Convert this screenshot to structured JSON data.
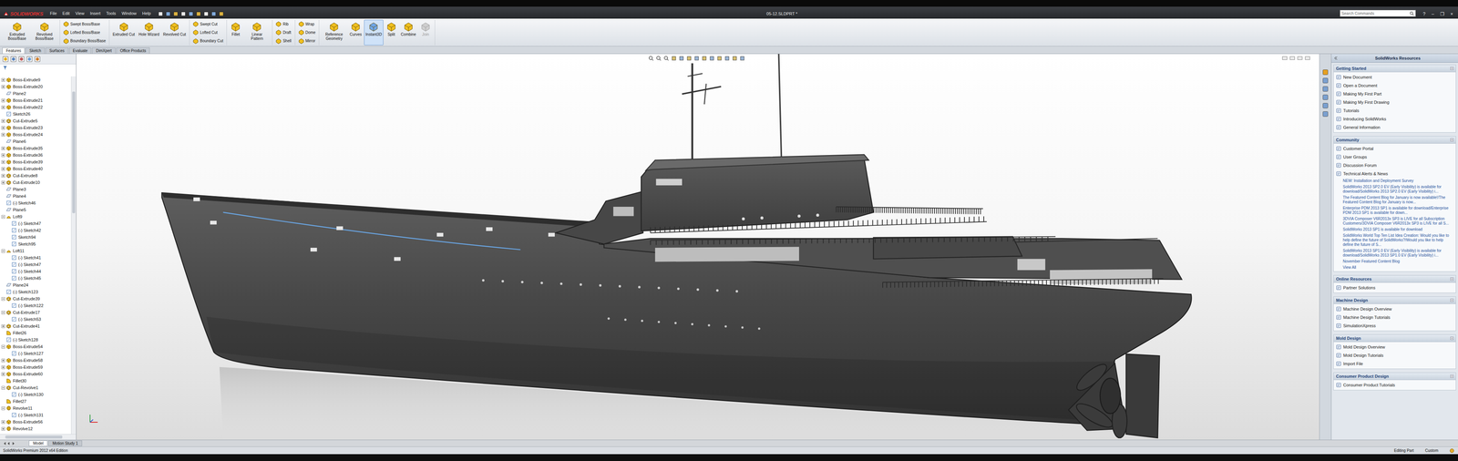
{
  "window": {
    "logo": "SOLIDWORKS",
    "title": "05-12.SLDPRT *",
    "controls": [
      "?",
      "–",
      "❐",
      "×"
    ]
  },
  "menu": [
    "File",
    "Edit",
    "View",
    "Insert",
    "Tools",
    "Window",
    "Help"
  ],
  "search": {
    "placeholder": "Search Commands"
  },
  "command_groups": [
    {
      "kind": "big",
      "items": [
        {
          "label": "Extruded Boss/Base",
          "selected": false,
          "disabled": false
        },
        {
          "label": "Revolved Boss/Base",
          "selected": false,
          "disabled": false
        }
      ]
    },
    {
      "kind": "stack",
      "items": [
        {
          "label": "Swept Boss/Base",
          "selected": false,
          "disabled": false
        },
        {
          "label": "Lofted Boss/Base",
          "selected": false,
          "disabled": false
        },
        {
          "label": "Boundary Boss/Base",
          "selected": false,
          "disabled": false
        }
      ]
    },
    {
      "kind": "big",
      "items": [
        {
          "label": "Extruded Cut",
          "selected": false,
          "disabled": false
        },
        {
          "label": "Hole Wizard",
          "selected": false,
          "disabled": false
        },
        {
          "label": "Revolved Cut",
          "selected": false,
          "disabled": false
        }
      ]
    },
    {
      "kind": "stack",
      "items": [
        {
          "label": "Swept Cut",
          "selected": false,
          "disabled": false
        },
        {
          "label": "Lofted Cut",
          "selected": false,
          "disabled": false
        },
        {
          "label": "Boundary Cut",
          "selected": false,
          "disabled": false
        }
      ]
    },
    {
      "kind": "big",
      "items": [
        {
          "label": "Fillet",
          "selected": false,
          "disabled": false
        },
        {
          "label": "Linear Pattern",
          "selected": false,
          "disabled": false
        }
      ]
    },
    {
      "kind": "stack",
      "items": [
        {
          "label": "Rib",
          "selected": false,
          "disabled": false
        },
        {
          "label": "Draft",
          "selected": false,
          "disabled": false
        },
        {
          "label": "Shell",
          "selected": false,
          "disabled": false
        }
      ]
    },
    {
      "kind": "stack",
      "items": [
        {
          "label": "Wrap",
          "selected": false,
          "disabled": false
        },
        {
          "label": "Dome",
          "selected": false,
          "disabled": false
        },
        {
          "label": "Mirror",
          "selected": false,
          "disabled": false
        }
      ]
    },
    {
      "kind": "big",
      "items": [
        {
          "label": "Reference Geometry",
          "selected": false,
          "disabled": false
        },
        {
          "label": "Curves",
          "selected": false,
          "disabled": false
        },
        {
          "label": "Instant3D",
          "selected": true,
          "disabled": false
        },
        {
          "label": "Split",
          "selected": false,
          "disabled": false
        },
        {
          "label": "Combine",
          "selected": false,
          "disabled": false
        },
        {
          "label": "Join",
          "selected": false,
          "disabled": true
        }
      ]
    }
  ],
  "command_tabs": [
    {
      "label": "Features",
      "selected": true
    },
    {
      "label": "Sketch",
      "selected": false
    },
    {
      "label": "Surfaces",
      "selected": false
    },
    {
      "label": "Evaluate",
      "selected": false
    },
    {
      "label": "DimXpert",
      "selected": false
    },
    {
      "label": "Office Products",
      "selected": false
    }
  ],
  "feature_tree": [
    {
      "label": "Boss-Extrude9",
      "kind": "extrude",
      "expanded": false
    },
    {
      "label": "Boss-Extrude20",
      "kind": "extrude",
      "expanded": false
    },
    {
      "label": "Plane2",
      "kind": "plane",
      "expanded": false
    },
    {
      "label": "Boss-Extrude21",
      "kind": "extrude",
      "expanded": false
    },
    {
      "label": "Boss-Extrude22",
      "kind": "extrude",
      "expanded": false
    },
    {
      "label": "Sketch26",
      "kind": "sketch",
      "expanded": false
    },
    {
      "label": "Cut-Extrude5",
      "kind": "cut",
      "expanded": false
    },
    {
      "label": "Boss-Extrude23",
      "kind": "extrude",
      "expanded": false
    },
    {
      "label": "Boss-Extrude24",
      "kind": "extrude",
      "expanded": false
    },
    {
      "label": "Plane6",
      "kind": "plane",
      "expanded": false
    },
    {
      "label": "Boss-Extrude35",
      "kind": "extrude",
      "expanded": false
    },
    {
      "label": "Boss-Extrude36",
      "kind": "extrude",
      "expanded": false
    },
    {
      "label": "Boss-Extrude39",
      "kind": "extrude",
      "expanded": false
    },
    {
      "label": "Boss-Extrude40",
      "kind": "extrude",
      "expanded": false
    },
    {
      "label": "Cut-Extrude8",
      "kind": "cut",
      "expanded": false
    },
    {
      "label": "Cut-Extrude10",
      "kind": "cut",
      "expanded": false
    },
    {
      "label": "Plane3",
      "kind": "plane",
      "expanded": false
    },
    {
      "label": "Plane4",
      "kind": "plane",
      "expanded": false
    },
    {
      "label": "(-) Sketch46",
      "kind": "sketch",
      "expanded": false
    },
    {
      "label": "Plane5",
      "kind": "plane",
      "expanded": false
    },
    {
      "label": "Loft9",
      "kind": "loft",
      "expanded": true,
      "children": [
        {
          "label": "(-) Sketch47",
          "kind": "sketch"
        },
        {
          "label": "(-) Sketch42",
          "kind": "sketch"
        },
        {
          "label": "Sketch94",
          "kind": "sketch"
        },
        {
          "label": "Sketch95",
          "kind": "sketch"
        }
      ]
    },
    {
      "label": "Loft11",
      "kind": "loft",
      "expanded": true,
      "children": [
        {
          "label": "(-) Sketch41",
          "kind": "sketch"
        },
        {
          "label": "(-) Sketch47",
          "kind": "sketch"
        },
        {
          "label": "(-) Sketch44",
          "kind": "sketch"
        },
        {
          "label": "(-) Sketch45",
          "kind": "sketch"
        }
      ]
    },
    {
      "label": "Plane24",
      "kind": "plane",
      "expanded": false
    },
    {
      "label": "(-) Sketch123",
      "kind": "sketch",
      "expanded": false
    },
    {
      "label": "Cut-Extrude39",
      "kind": "cut",
      "expanded": true,
      "children": [
        {
          "label": "(-) Sketch122",
          "kind": "sketch"
        }
      ]
    },
    {
      "label": "Cut-Extrude17",
      "kind": "cut",
      "expanded": true,
      "children": [
        {
          "label": "(-) Sketch53",
          "kind": "sketch"
        }
      ]
    },
    {
      "label": "Cut-Extrude41",
      "kind": "cut",
      "expanded": false
    },
    {
      "label": "Fillet26",
      "kind": "fillet",
      "expanded": false
    },
    {
      "label": "(-) Sketch128",
      "kind": "sketch",
      "expanded": false
    },
    {
      "label": "Boss-Extrude54",
      "kind": "extrude",
      "expanded": true,
      "children": [
        {
          "label": "(-) Sketch127",
          "kind": "sketch"
        }
      ]
    },
    {
      "label": "Boss-Extrude58",
      "kind": "extrude",
      "expanded": false
    },
    {
      "label": "Boss-Extrude59",
      "kind": "extrude",
      "expanded": false
    },
    {
      "label": "Boss-Extrude60",
      "kind": "extrude",
      "expanded": false
    },
    {
      "label": "Fillet30",
      "kind": "fillet",
      "expanded": false
    },
    {
      "label": "Cut-Revolve1",
      "kind": "cut",
      "expanded": true,
      "children": [
        {
          "label": "(-) Sketch130",
          "kind": "sketch"
        }
      ]
    },
    {
      "label": "Fillet27",
      "kind": "fillet",
      "expanded": false
    },
    {
      "label": "Revolve11",
      "kind": "revolve",
      "expanded": true,
      "children": [
        {
          "label": "(-) Sketch131",
          "kind": "sketch"
        }
      ]
    },
    {
      "label": "Boss-Extrude56",
      "kind": "extrude",
      "expanded": false
    },
    {
      "label": "Revolve12",
      "kind": "revolve",
      "expanded": false
    }
  ],
  "task_pane": {
    "title": "SolidWorks Resources",
    "sections": [
      {
        "title": "Getting Started",
        "items": [
          {
            "label": "New Document",
            "kind": "link"
          },
          {
            "label": "Open a Document",
            "kind": "link"
          },
          {
            "label": "Making My First Part",
            "kind": "link"
          },
          {
            "label": "Making My First Drawing",
            "kind": "link"
          },
          {
            "label": "Tutorials",
            "kind": "link"
          },
          {
            "label": "Introducing SolidWorks",
            "kind": "link"
          },
          {
            "label": "General Information",
            "kind": "link"
          }
        ]
      },
      {
        "title": "Community",
        "items": [
          {
            "label": "Customer Portal",
            "kind": "link"
          },
          {
            "label": "User Groups",
            "kind": "link"
          },
          {
            "label": "Discussion Forum",
            "kind": "link"
          },
          {
            "label": "Technical Alerts & News",
            "kind": "link"
          },
          {
            "label": "NEW: Installation and Deployment Survey",
            "kind": "news"
          },
          {
            "label": "SolidWorks 2013 SP2.0 EV (Early Visibility) is available for download/SolidWorks 2013 SP2.0 EV (Early Visibility) i...",
            "kind": "news"
          },
          {
            "label": "The Featured Content Blog for January is now available!/The Featured Content Blog for January is now...",
            "kind": "news"
          },
          {
            "label": "Enterprise PDM 2013 SP1 is available for download/Enterprise PDM 2013 SP1 is available for down...",
            "kind": "news"
          },
          {
            "label": "3DVIA Composer V6R2013x SP3 is LIVE for all Subscription Customers/3DVIA Composer V6R2013x SP3 is LIVE for all S...",
            "kind": "news"
          },
          {
            "label": "SolidWorks 2013 SP1 is available for download",
            "kind": "news"
          },
          {
            "label": "SolidWorks World Top Ten List Idea Creation: Would you like to help define the future of SolidWorks?/Would you like to help define the future of S...",
            "kind": "news"
          },
          {
            "label": "SolidWorks 2013 SP1.0 EV (Early Visibility) is available for download/SolidWorks 2013 SP1.0 EV (Early Visibility) i...",
            "kind": "news"
          },
          {
            "label": "November Featured Content Blog",
            "kind": "news"
          },
          {
            "label": "View All",
            "kind": "more"
          }
        ]
      },
      {
        "title": "Online Resources",
        "items": [
          {
            "label": "Partner Solutions",
            "kind": "link"
          }
        ]
      },
      {
        "title": "Machine Design",
        "items": [
          {
            "label": "Machine Design Overview",
            "kind": "link"
          },
          {
            "label": "Machine Design Tutorials",
            "kind": "link"
          },
          {
            "label": "SimulationXpress",
            "kind": "link"
          }
        ]
      },
      {
        "title": "Mold Design",
        "items": [
          {
            "label": "Mold Design Overview",
            "kind": "link"
          },
          {
            "label": "Mold Design Tutorials",
            "kind": "link"
          },
          {
            "label": "Import File",
            "kind": "link"
          }
        ]
      },
      {
        "title": "Consumer Product Design",
        "items": [
          {
            "label": "Consumer Product Tutorials",
            "kind": "link"
          }
        ]
      }
    ]
  },
  "model_tabs": [
    {
      "label": "Model",
      "selected": true
    },
    {
      "label": "Motion Study 1",
      "selected": false
    }
  ],
  "status_bar": {
    "left": "SolidWorks Premium 2012 x64 Edition",
    "mode": "Editing Part",
    "units": "Custom"
  }
}
